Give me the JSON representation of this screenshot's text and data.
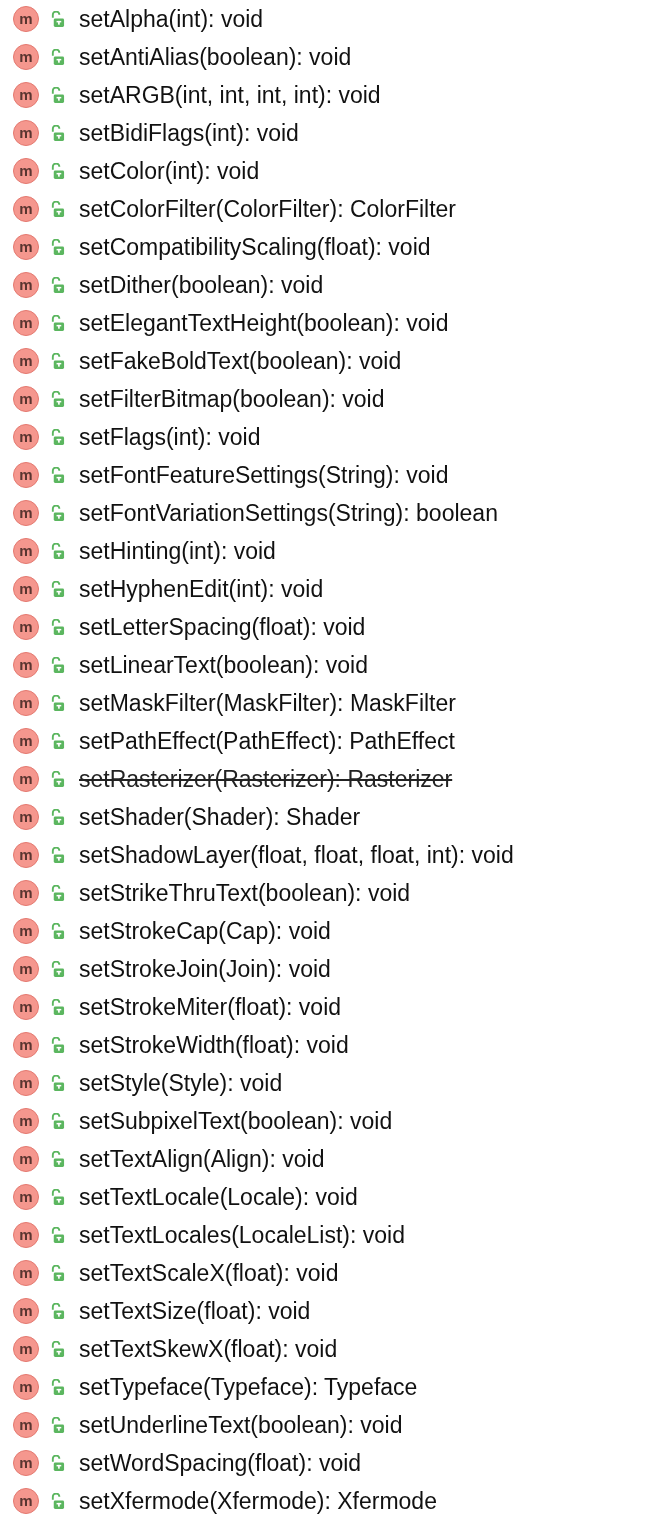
{
  "methods": [
    {
      "badge": "m",
      "signature": "setAlpha(int): void",
      "deprecated": false
    },
    {
      "badge": "m",
      "signature": "setAntiAlias(boolean): void",
      "deprecated": false
    },
    {
      "badge": "m",
      "signature": "setARGB(int, int, int, int): void",
      "deprecated": false
    },
    {
      "badge": "m",
      "signature": "setBidiFlags(int): void",
      "deprecated": false
    },
    {
      "badge": "m",
      "signature": "setColor(int): void",
      "deprecated": false
    },
    {
      "badge": "m",
      "signature": "setColorFilter(ColorFilter): ColorFilter",
      "deprecated": false
    },
    {
      "badge": "m",
      "signature": "setCompatibilityScaling(float): void",
      "deprecated": false
    },
    {
      "badge": "m",
      "signature": "setDither(boolean): void",
      "deprecated": false
    },
    {
      "badge": "m",
      "signature": "setElegantTextHeight(boolean): void",
      "deprecated": false
    },
    {
      "badge": "m",
      "signature": "setFakeBoldText(boolean): void",
      "deprecated": false
    },
    {
      "badge": "m",
      "signature": "setFilterBitmap(boolean): void",
      "deprecated": false
    },
    {
      "badge": "m",
      "signature": "setFlags(int): void",
      "deprecated": false
    },
    {
      "badge": "m",
      "signature": "setFontFeatureSettings(String): void",
      "deprecated": false
    },
    {
      "badge": "m",
      "signature": "setFontVariationSettings(String): boolean",
      "deprecated": false
    },
    {
      "badge": "m",
      "signature": "setHinting(int): void",
      "deprecated": false
    },
    {
      "badge": "m",
      "signature": "setHyphenEdit(int): void",
      "deprecated": false
    },
    {
      "badge": "m",
      "signature": "setLetterSpacing(float): void",
      "deprecated": false
    },
    {
      "badge": "m",
      "signature": "setLinearText(boolean): void",
      "deprecated": false
    },
    {
      "badge": "m",
      "signature": "setMaskFilter(MaskFilter): MaskFilter",
      "deprecated": false
    },
    {
      "badge": "m",
      "signature": "setPathEffect(PathEffect): PathEffect",
      "deprecated": false
    },
    {
      "badge": "m",
      "signature": "setRasterizer(Rasterizer): Rasterizer",
      "deprecated": true
    },
    {
      "badge": "m",
      "signature": "setShader(Shader): Shader",
      "deprecated": false
    },
    {
      "badge": "m",
      "signature": "setShadowLayer(float, float, float, int): void",
      "deprecated": false
    },
    {
      "badge": "m",
      "signature": "setStrikeThruText(boolean): void",
      "deprecated": false
    },
    {
      "badge": "m",
      "signature": "setStrokeCap(Cap): void",
      "deprecated": false
    },
    {
      "badge": "m",
      "signature": "setStrokeJoin(Join): void",
      "deprecated": false
    },
    {
      "badge": "m",
      "signature": "setStrokeMiter(float): void",
      "deprecated": false
    },
    {
      "badge": "m",
      "signature": "setStrokeWidth(float): void",
      "deprecated": false
    },
    {
      "badge": "m",
      "signature": "setStyle(Style): void",
      "deprecated": false
    },
    {
      "badge": "m",
      "signature": "setSubpixelText(boolean): void",
      "deprecated": false
    },
    {
      "badge": "m",
      "signature": "setTextAlign(Align): void",
      "deprecated": false
    },
    {
      "badge": "m",
      "signature": "setTextLocale(Locale): void",
      "deprecated": false
    },
    {
      "badge": "m",
      "signature": "setTextLocales(LocaleList): void",
      "deprecated": false
    },
    {
      "badge": "m",
      "signature": "setTextScaleX(float): void",
      "deprecated": false
    },
    {
      "badge": "m",
      "signature": "setTextSize(float): void",
      "deprecated": false
    },
    {
      "badge": "m",
      "signature": "setTextSkewX(float): void",
      "deprecated": false
    },
    {
      "badge": "m",
      "signature": "setTypeface(Typeface): Typeface",
      "deprecated": false
    },
    {
      "badge": "m",
      "signature": "setUnderlineText(boolean): void",
      "deprecated": false
    },
    {
      "badge": "m",
      "signature": "setWordSpacing(float): void",
      "deprecated": false
    },
    {
      "badge": "m",
      "signature": "setXfermode(Xfermode): Xfermode",
      "deprecated": false
    }
  ]
}
